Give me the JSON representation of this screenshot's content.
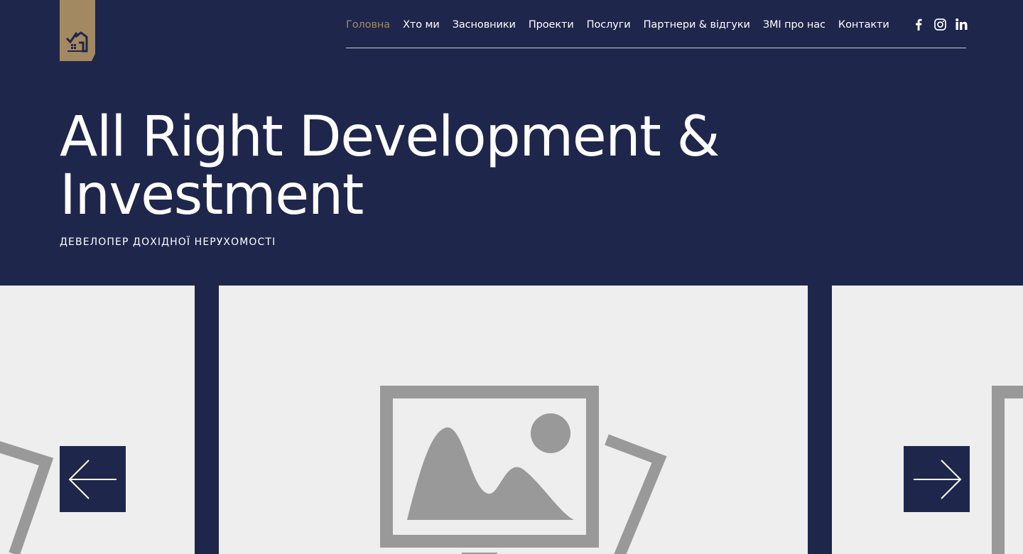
{
  "header": {
    "logo_icon": "house-check-icon",
    "nav": [
      {
        "label": "Головна",
        "active": true
      },
      {
        "label": "Хто ми",
        "active": false
      },
      {
        "label": "Засновники",
        "active": false
      },
      {
        "label": "Проекти",
        "active": false
      },
      {
        "label": "Послуги",
        "active": false
      },
      {
        "label": "Партнери & відгуки",
        "active": false
      },
      {
        "label": "ЗМІ про нас",
        "active": false
      },
      {
        "label": "Контакти",
        "active": false
      }
    ],
    "social": [
      "facebook-icon",
      "instagram-icon",
      "linkedin-icon"
    ]
  },
  "hero": {
    "title": "All Right Development & Investment",
    "subtitle": "ДЕВЕЛОПЕР ДОХІДНОЇ НЕРУХОМОСТІ"
  },
  "carousel": {
    "slides": [
      "image-placeholder",
      "image-placeholder",
      "image-placeholder"
    ],
    "prev_icon": "arrow-left-icon",
    "next_icon": "arrow-right-icon"
  },
  "colors": {
    "background": "#1f264b",
    "accent": "#a38962",
    "text": "#ffffff",
    "placeholder_bg": "#eeeeef",
    "placeholder_icon": "#999999"
  }
}
